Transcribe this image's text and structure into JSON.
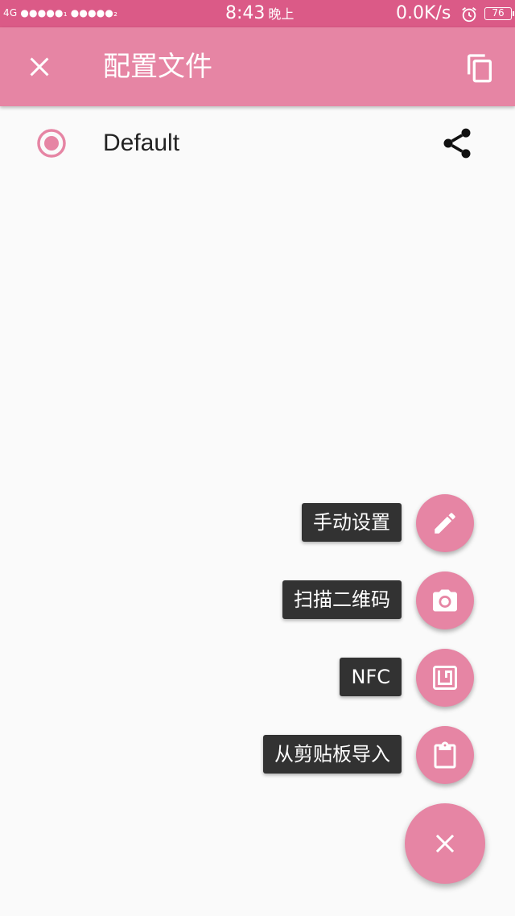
{
  "status_bar": {
    "signal_text": "4G ●●●●●₁ ●●●●●₂",
    "time": "8:43",
    "time_suffix": "晚上",
    "net_speed": "0.0K/s",
    "battery": "76"
  },
  "toolbar": {
    "title": "配置文件",
    "close_icon": "close-icon",
    "copy_icon": "copy-icon"
  },
  "profiles": [
    {
      "name": "Default",
      "selected": true
    }
  ],
  "fab_menu": {
    "items": [
      {
        "label": "手动设置",
        "icon": "edit-icon"
      },
      {
        "label": "扫描二维码",
        "icon": "camera-icon"
      },
      {
        "label": "NFC",
        "icon": "nfc-icon"
      },
      {
        "label": "从剪贴板导入",
        "icon": "clipboard-icon"
      }
    ],
    "main_icon": "close-icon"
  },
  "colors": {
    "status_bar": "#db5a87",
    "toolbar": "#e685a4",
    "accent": "#e685a4",
    "label_bg": "#323232"
  }
}
